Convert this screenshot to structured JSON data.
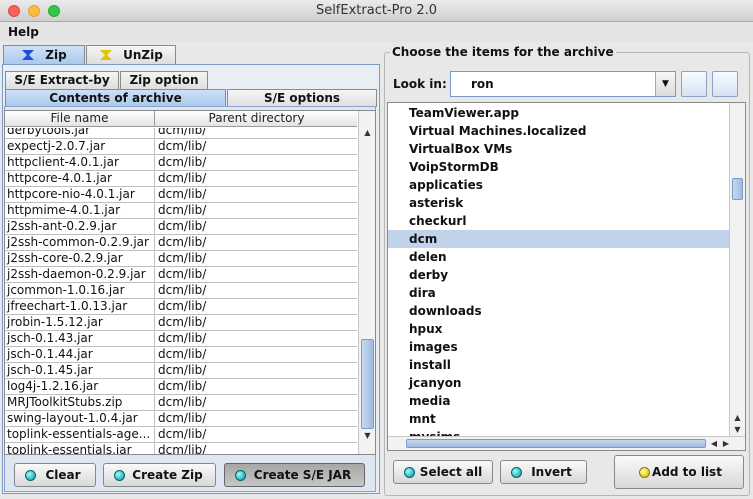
{
  "window": {
    "title": "SelfExtract-Pro 2.0"
  },
  "menubar": {
    "help": "Help"
  },
  "main_tabs": [
    {
      "label": "Zip",
      "active": true
    },
    {
      "label": "UnZip",
      "active": false
    }
  ],
  "sub_tabs_row1": [
    {
      "label": "S/E Extract-by"
    },
    {
      "label": "Zip option"
    }
  ],
  "sub_tabs_row2": [
    {
      "label": "Contents of archive",
      "active": true
    },
    {
      "label": "S/E options",
      "active": false
    }
  ],
  "archive_table": {
    "columns": [
      "File name",
      "Parent directory"
    ],
    "rows": [
      [
        "derbytools.jar",
        "dcm/lib/"
      ],
      [
        "expectj-2.0.7.jar",
        "dcm/lib/"
      ],
      [
        "httpclient-4.0.1.jar",
        "dcm/lib/"
      ],
      [
        "httpcore-4.0.1.jar",
        "dcm/lib/"
      ],
      [
        "httpcore-nio-4.0.1.jar",
        "dcm/lib/"
      ],
      [
        "httpmime-4.0.1.jar",
        "dcm/lib/"
      ],
      [
        "j2ssh-ant-0.2.9.jar",
        "dcm/lib/"
      ],
      [
        "j2ssh-common-0.2.9.jar",
        "dcm/lib/"
      ],
      [
        "j2ssh-core-0.2.9.jar",
        "dcm/lib/"
      ],
      [
        "j2ssh-daemon-0.2.9.jar",
        "dcm/lib/"
      ],
      [
        "jcommon-1.0.16.jar",
        "dcm/lib/"
      ],
      [
        "jfreechart-1.0.13.jar",
        "dcm/lib/"
      ],
      [
        "jrobin-1.5.12.jar",
        "dcm/lib/"
      ],
      [
        "jsch-0.1.43.jar",
        "dcm/lib/"
      ],
      [
        "jsch-0.1.44.jar",
        "dcm/lib/"
      ],
      [
        "jsch-0.1.45.jar",
        "dcm/lib/"
      ],
      [
        "log4j-1.2.16.jar",
        "dcm/lib/"
      ],
      [
        "MRJToolkitStubs.zip",
        "dcm/lib/"
      ],
      [
        "swing-layout-1.0.4.jar",
        "dcm/lib/"
      ],
      [
        "toplink-essentials-age...",
        "dcm/lib/"
      ],
      [
        "toplink-essentials.jar",
        "dcm/lib/"
      ]
    ]
  },
  "left_buttons": {
    "clear": "Clear",
    "create_zip": "Create Zip",
    "create_se_jar": "Create S/E JAR"
  },
  "chooser": {
    "group_title": "Choose the items for the archive",
    "look_in_label": "Look in:",
    "look_in_value": "ron",
    "items": [
      "TeamViewer.app",
      "Virtual Machines.localized",
      "VirtualBox VMs",
      "VoipStormDB",
      "applicaties",
      "asterisk",
      "checkurl",
      "dcm",
      "delen",
      "derby",
      "dira",
      "downloads",
      "hpux",
      "images",
      "install",
      "jcanyon",
      "media",
      "mnt",
      "mysims"
    ],
    "selected_item": "dcm"
  },
  "right_buttons": {
    "select_all": "Select all",
    "invert": "Invert",
    "add_to_list": "Add to list"
  }
}
